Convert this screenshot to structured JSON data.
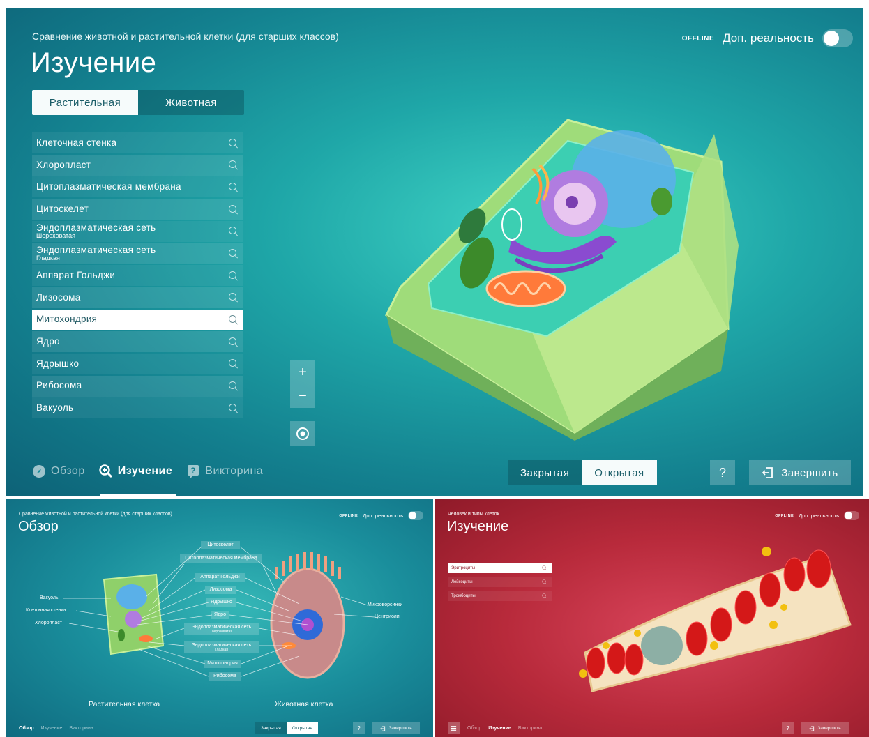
{
  "main": {
    "subtitle": "Сравнение животной и растительной клетки (для старших классов)",
    "title": "Изучение",
    "offline": "OFFLINE",
    "ar_label": "Доп. реальность",
    "tabs": [
      "Растительная",
      "Животная"
    ],
    "items": [
      {
        "label": "Клеточная стенка",
        "sub": ""
      },
      {
        "label": "Хлоропласт",
        "sub": ""
      },
      {
        "label": "Цитоплазматическая мембрана",
        "sub": ""
      },
      {
        "label": "Цитоскелет",
        "sub": ""
      },
      {
        "label": "Эндоплазматическая сеть",
        "sub": "Шероховатая"
      },
      {
        "label": "Эндоплазматическая сеть",
        "sub": "Гладкая"
      },
      {
        "label": "Аппарат Гольджи",
        "sub": ""
      },
      {
        "label": "Лизосома",
        "sub": ""
      },
      {
        "label": "Митохондрия",
        "sub": ""
      },
      {
        "label": "Ядро",
        "sub": ""
      },
      {
        "label": "Ядрышко",
        "sub": ""
      },
      {
        "label": "Рибосома",
        "sub": ""
      },
      {
        "label": "Вакуоль",
        "sub": ""
      }
    ],
    "selected_index": 8,
    "zoom_in": "+",
    "zoom_out": "−",
    "nav": {
      "overview": "Обзор",
      "study": "Изучение",
      "quiz": "Викторина"
    },
    "closed": "Закрытая",
    "open": "Открытая",
    "help": "?",
    "finish": "Завершить",
    "colors": {
      "accent_bg": "#1fa7a8"
    }
  },
  "overview": {
    "subtitle": "Сравнение животной и растительной клетки (для старших классов)",
    "title": "Обзор",
    "offline": "OFFLINE",
    "ar_label": "Доп. реальность",
    "center_labels": [
      {
        "label": "Цитоскелет",
        "sub": ""
      },
      {
        "label": "Цитоплазматическая мембрана",
        "sub": ""
      },
      {
        "label": "Аппарат Гольджи",
        "sub": ""
      },
      {
        "label": "Лизосома",
        "sub": ""
      },
      {
        "label": "Ядрышко",
        "sub": ""
      },
      {
        "label": "Ядро",
        "sub": ""
      },
      {
        "label": "Эндоплазматическая сеть",
        "sub": "Шероховатая"
      },
      {
        "label": "Эндоплазматическая сеть",
        "sub": "Гладкая"
      },
      {
        "label": "Митохондрия",
        "sub": ""
      },
      {
        "label": "Рибосома",
        "sub": ""
      }
    ],
    "left_labels": [
      "Вакуоль",
      "Клеточная стенка",
      "Хлоропласт"
    ],
    "right_labels": [
      "Микроворсинки",
      "Центриоли"
    ],
    "plant_caption": "Растительная клетка",
    "animal_caption": "Животная клетка",
    "nav": {
      "overview": "Обзор",
      "study": "Изучение",
      "quiz": "Викторина"
    },
    "closed": "Закрытая",
    "open": "Открытая",
    "help": "?",
    "finish": "Завершить"
  },
  "blood": {
    "subtitle": "Человек и типы клеток",
    "title": "Изучение",
    "offline": "OFFLINE",
    "ar_label": "Доп. реальность",
    "items": [
      "Эритроциты",
      "Лейкоциты",
      "Тромбоциты"
    ],
    "selected_index": 0,
    "nav": {
      "overview": "Обзор",
      "study": "Изучение",
      "quiz": "Викторина"
    },
    "help": "?",
    "finish": "Завершить"
  }
}
